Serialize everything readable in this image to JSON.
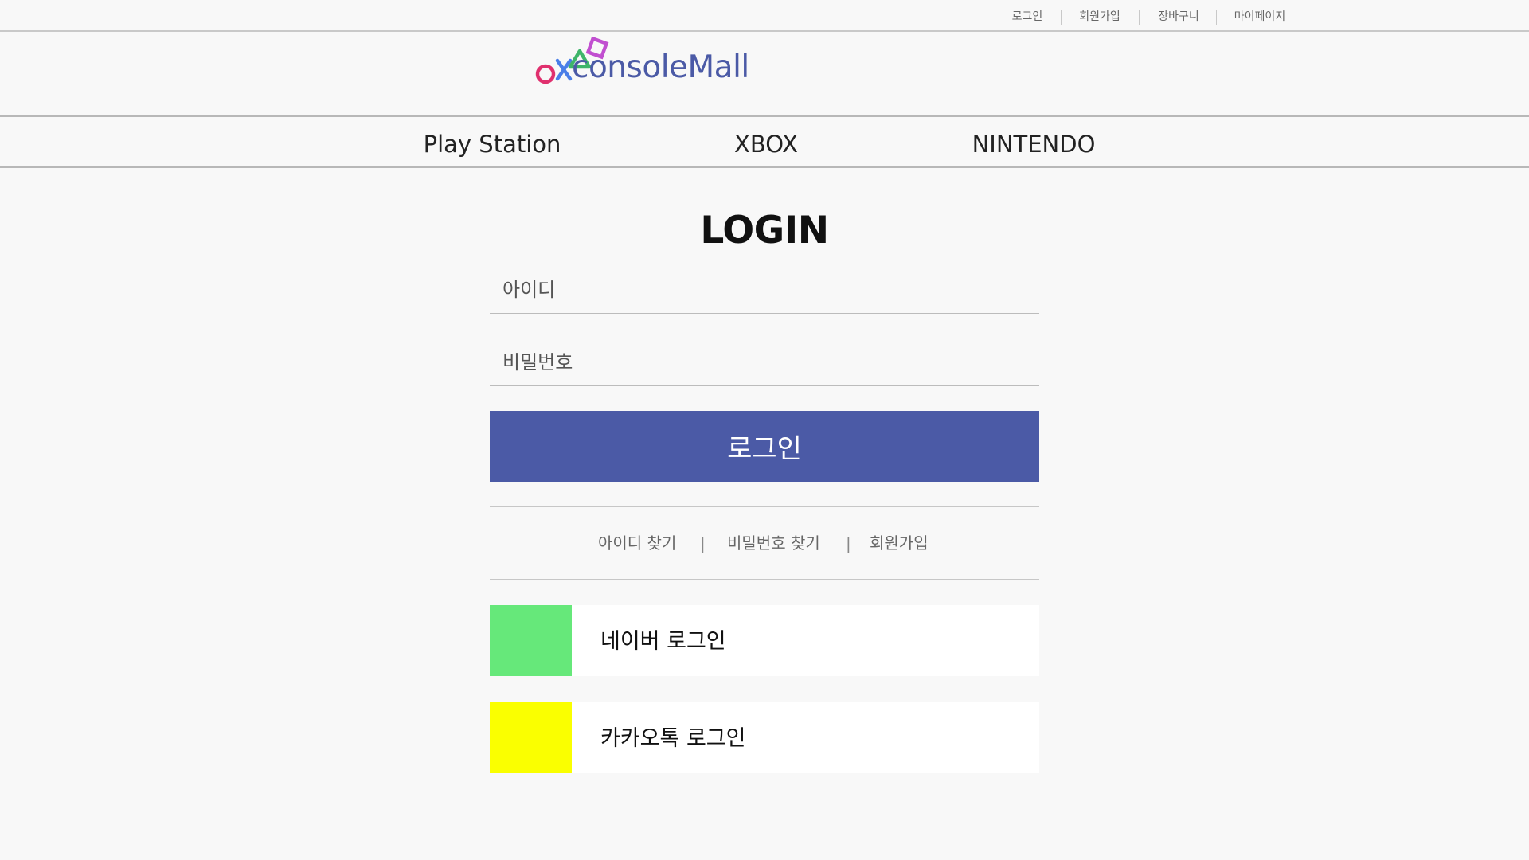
{
  "utility_nav": {
    "login": "로그인",
    "signup": "회원가입",
    "cart": "장바구니",
    "mypage": "마이페이지"
  },
  "logo": {
    "text": "consoleMall",
    "colors": {
      "circle": "#e0306e",
      "cross": "#4a7ee8",
      "triangle": "#3fb56a",
      "square": "#c14fd0",
      "text": "#4b5aa6"
    }
  },
  "categories": {
    "playstation": "Play Station",
    "xbox": "XBOX",
    "nintendo": "NINTENDO"
  },
  "login": {
    "title": "LOGIN",
    "id_placeholder": "아이디",
    "password_placeholder": "비밀번호",
    "submit_label": "로그인"
  },
  "helper_links": {
    "find_id": "아이디 찾기",
    "separator": "|",
    "find_password": "비밀번호 찾기",
    "signup": "회원가입"
  },
  "social_login": {
    "naver": {
      "label": "네이버 로그인",
      "color": "#66e87a"
    },
    "kakao": {
      "label": "카카오톡 로그인",
      "color": "#faff00"
    }
  },
  "colors": {
    "accent": "#4b5aa6",
    "background": "#f8f8f8"
  }
}
